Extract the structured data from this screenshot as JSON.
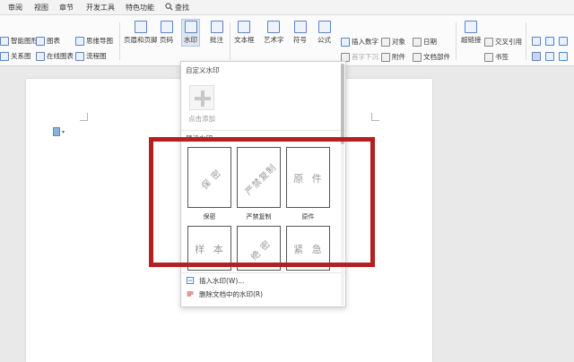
{
  "menu": {
    "tabs": [
      "审阅",
      "视图",
      "章节",
      "开发工具",
      "特色功能",
      "查找"
    ]
  },
  "ribbon": {
    "left_row1": [
      "智能图形",
      "图表",
      "思维导图"
    ],
    "left_row2": [
      "关系图",
      "在线图表",
      "流程图"
    ],
    "big_buttons": [
      "页眉和页脚",
      "页码",
      "水印",
      "批注",
      "文本框",
      "艺术字",
      "符号",
      "公式"
    ],
    "mid_row1": [
      "插入数字",
      "对象",
      "日期"
    ],
    "mid_row2": [
      "首字下沉",
      "附件",
      "文档部件"
    ],
    "right_items": [
      "超链接",
      "交叉引用",
      "书签"
    ]
  },
  "watermark_menu": {
    "custom_section": "自定义水印",
    "add_label": "点击添加",
    "preset_section": "预设水印",
    "presets": [
      {
        "text": "保 密",
        "label": "保密"
      },
      {
        "text": "严禁复制",
        "label": "严禁复制"
      },
      {
        "text": "原 件",
        "label": "原件"
      },
      {
        "text": "样 本",
        "label": ""
      },
      {
        "text": "绝 密",
        "label": ""
      },
      {
        "text": "紧 急",
        "label": ""
      }
    ],
    "insert_label": "插入水印(W)...",
    "delete_label": "删除文档中的水印(R)"
  },
  "colors": {
    "highlight": "#b51f1f",
    "accent": "#5a83c7"
  }
}
